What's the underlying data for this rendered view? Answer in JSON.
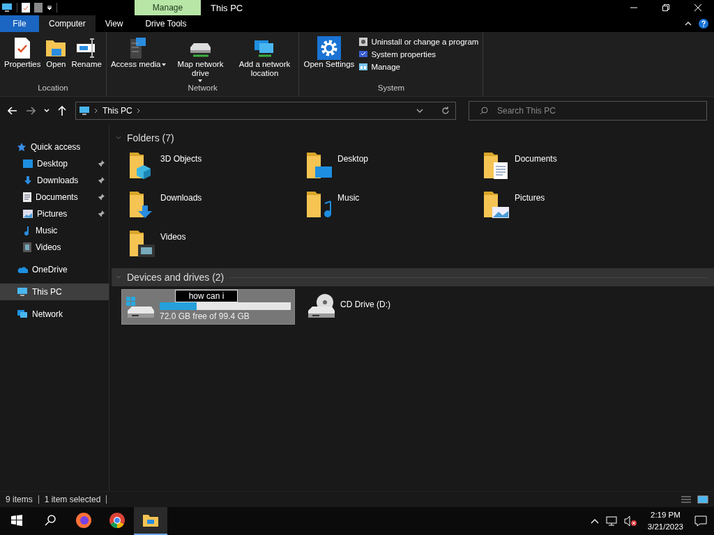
{
  "title_bar": {
    "context_tab": "Manage",
    "title": "This PC"
  },
  "ribbon_tabs": [
    {
      "label": "File",
      "kind": "file",
      "selected": false
    },
    {
      "label": "Computer",
      "kind": "tab",
      "selected": true
    },
    {
      "label": "View",
      "kind": "tab",
      "selected": false
    },
    {
      "label": "Drive Tools",
      "kind": "tab",
      "selected": false
    }
  ],
  "ribbon_groups": [
    {
      "label": "Location",
      "items": [
        {
          "label": "Properties",
          "kind": "large",
          "dropdown": false
        },
        {
          "label": "Open",
          "kind": "large",
          "dropdown": false
        },
        {
          "label": "Rename",
          "kind": "large",
          "dropdown": false
        }
      ]
    },
    {
      "label": "Network",
      "items": [
        {
          "label": "Access media",
          "kind": "large",
          "dropdown": true
        },
        {
          "label": "Map network drive",
          "kind": "large",
          "dropdown": true
        },
        {
          "label": "Add a network location",
          "kind": "large",
          "dropdown": false
        }
      ]
    },
    {
      "label": "System",
      "items": [
        {
          "label": "Open Settings",
          "kind": "large",
          "dropdown": false
        },
        {
          "label": "Uninstall or change a program",
          "kind": "small"
        },
        {
          "label": "System properties",
          "kind": "small"
        },
        {
          "label": "Manage",
          "kind": "small"
        }
      ]
    }
  ],
  "address": {
    "path": "This PC"
  },
  "search": {
    "placeholder": "Search This PC"
  },
  "sidebar": [
    {
      "label": "Quick access",
      "selected": false,
      "pinned": false,
      "children": [
        {
          "label": "Desktop",
          "selected": false,
          "pinned": true
        },
        {
          "label": "Downloads",
          "selected": false,
          "pinned": true
        },
        {
          "label": "Documents",
          "selected": false,
          "pinned": true
        },
        {
          "label": "Pictures",
          "selected": false,
          "pinned": true
        },
        {
          "label": "Music",
          "selected": false,
          "pinned": false
        },
        {
          "label": "Videos",
          "selected": false,
          "pinned": false
        }
      ]
    },
    {
      "label": "OneDrive",
      "selected": false,
      "pinned": false
    },
    {
      "label": "This PC",
      "selected": true,
      "pinned": false
    },
    {
      "label": "Network",
      "selected": false,
      "pinned": false
    }
  ],
  "folders": {
    "title": "Folders (7)",
    "items": [
      {
        "name": "3D Objects"
      },
      {
        "name": "Desktop"
      },
      {
        "name": "Documents"
      },
      {
        "name": "Downloads"
      },
      {
        "name": "Music"
      },
      {
        "name": "Pictures"
      },
      {
        "name": "Videos"
      }
    ]
  },
  "drives": {
    "title": "Devices and drives (2)",
    "items": [
      {
        "kind": "disk",
        "selected": true,
        "rename_value": "how can i",
        "level": 0.28,
        "free": "72.0 GB free of 99.4 GB"
      },
      {
        "kind": "cd",
        "selected": false,
        "name": "CD Drive (D:)"
      }
    ]
  },
  "status_bar": [
    "9 items",
    "1 item selected"
  ],
  "taskbar": {
    "time": "2:19 PM",
    "date": "3/21/2023"
  }
}
